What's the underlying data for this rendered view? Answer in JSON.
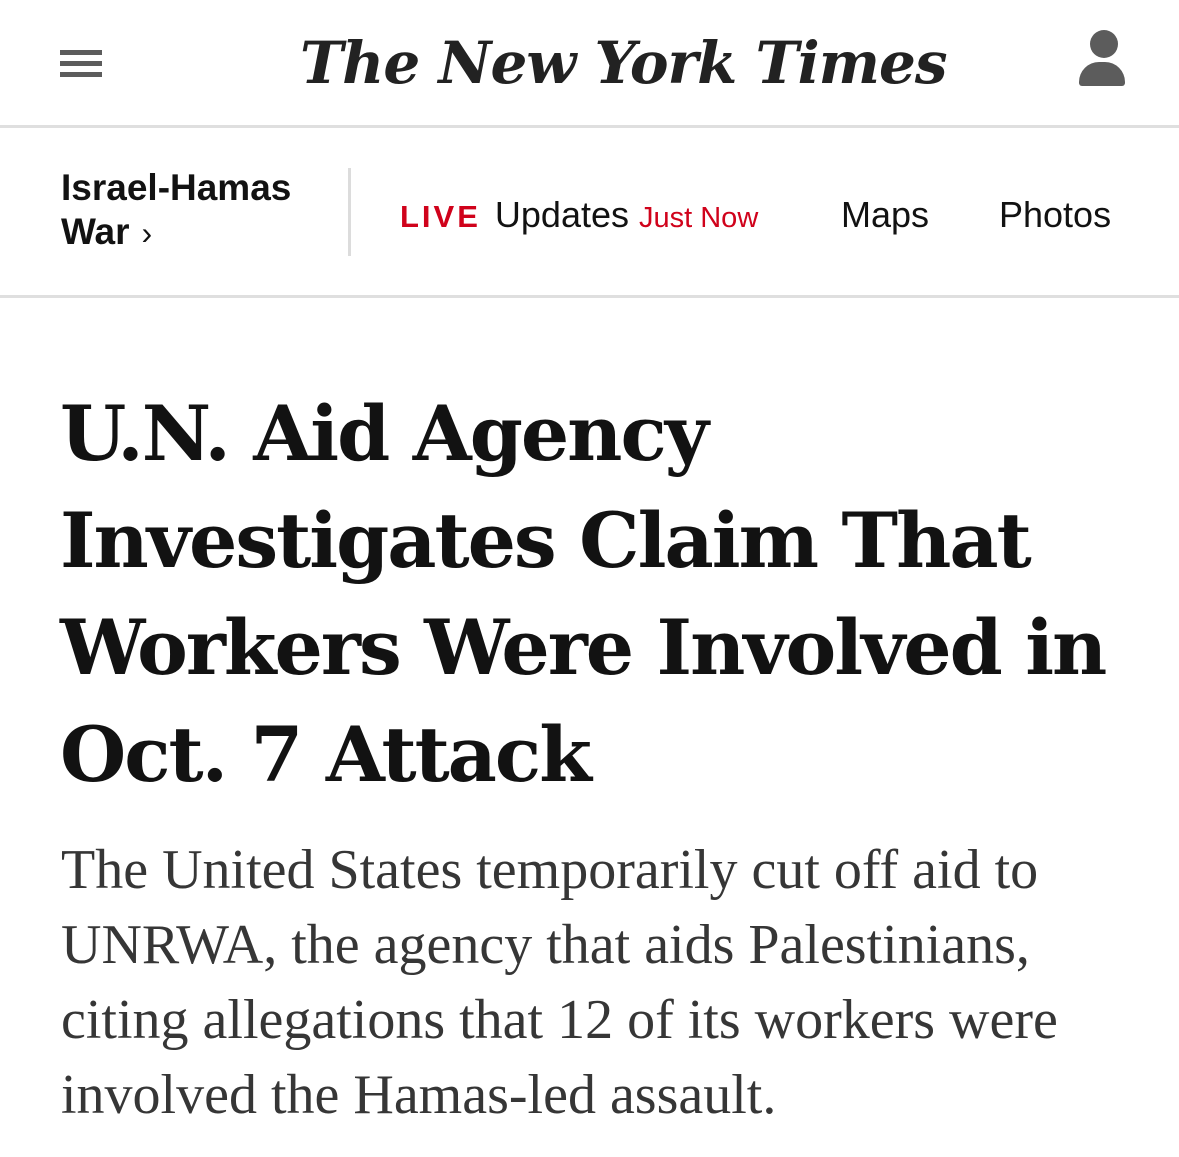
{
  "header": {
    "logo_text": "The New York Times",
    "menu_icon": "hamburger-menu-icon",
    "account_icon": "user-account-icon"
  },
  "section_nav": {
    "section_title": "Israel-Hamas War",
    "section_chevron": "›",
    "live_badge": "LIVE",
    "updates_label": "Updates",
    "timestamp": "Just Now",
    "maps_label": "Maps",
    "photos_label": "Photos"
  },
  "article": {
    "headline": "U.N. Aid Agency Investigates Claim That Workers Were Involved in Oct. 7 Attack",
    "summary": "The United States temporarily cut off aid to UNRWA, the agency that aids Palestinians, citing allegations that 12 of its workers were involved the Hamas-led assault."
  },
  "colors": {
    "live_red": "#d0021b",
    "text": "#121212",
    "icon_gray": "#5c5c5c",
    "divider": "#dfdfdf"
  }
}
